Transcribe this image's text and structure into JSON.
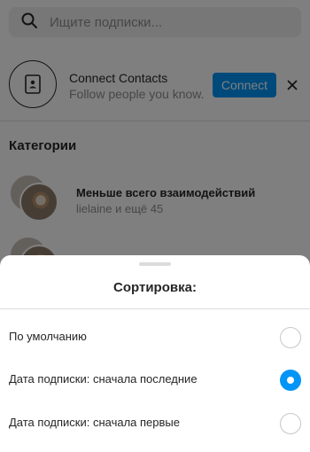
{
  "search": {
    "placeholder": "Ищите подписки...",
    "value": ""
  },
  "connect": {
    "title": "Connect Contacts",
    "subtitle": "Follow people you know.",
    "button_label": "Connect"
  },
  "categories": {
    "heading": "Категории",
    "items": [
      {
        "title": "Меньше всего взаимодействий",
        "subtitle": "lielaine и ещё 45"
      },
      {
        "title": "",
        "subtitle": ""
      }
    ]
  },
  "sort_sheet": {
    "title": "Сортировка:",
    "options": [
      {
        "label": "По умолчанию",
        "selected": false
      },
      {
        "label": "Дата подписки: сначала последние",
        "selected": true
      },
      {
        "label": "Дата подписки: сначала первые",
        "selected": false
      }
    ]
  },
  "colors": {
    "accent": "#0095f6",
    "text": "#262626",
    "muted": "#8e8e8e",
    "divider": "#dbdbdb"
  },
  "icons": [
    "search-icon",
    "contact-book-icon",
    "close-icon"
  ]
}
